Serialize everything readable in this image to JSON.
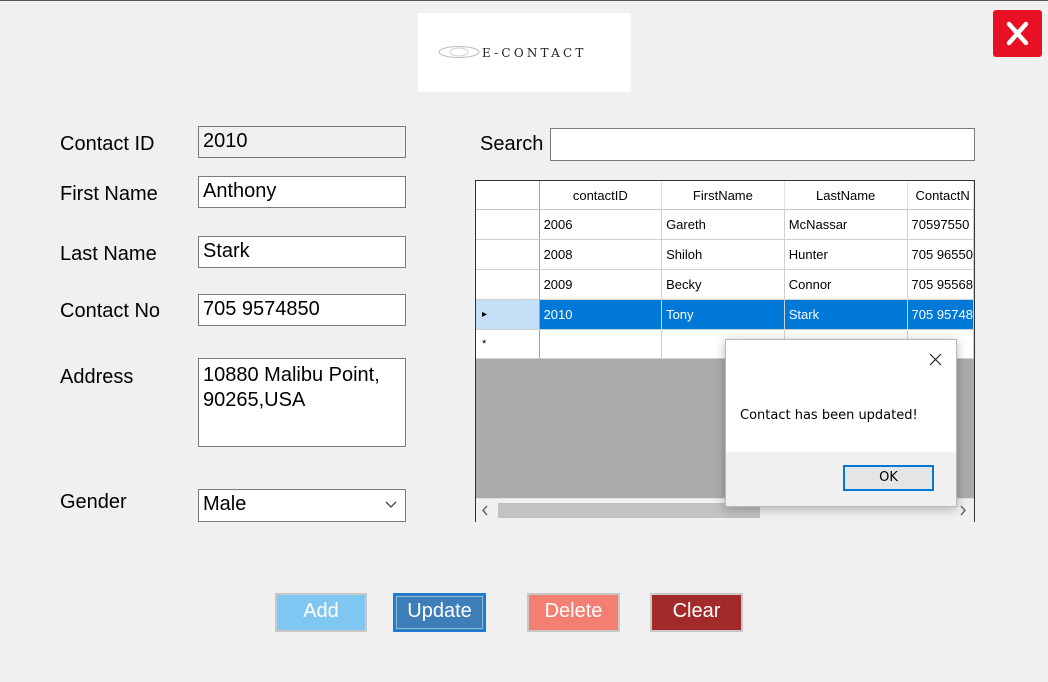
{
  "logo": {
    "text": "E-CONTACT"
  },
  "form": {
    "contact_id_label": "Contact ID",
    "contact_id_value": "2010",
    "first_name_label": "First Name",
    "first_name_value": "Anthony",
    "last_name_label": "Last Name",
    "last_name_value": "Stark",
    "contact_no_label": "Contact No",
    "contact_no_value": "705 9574850",
    "address_label": "Address",
    "address_value": "10880 Malibu Point, 90265,USA",
    "gender_label": "Gender",
    "gender_value": "Male"
  },
  "search": {
    "label": "Search",
    "value": ""
  },
  "grid": {
    "headers": [
      "contactID",
      "FirstName",
      "LastName",
      "ContactN"
    ],
    "rows": [
      {
        "contactID": "2006",
        "FirstName": "Gareth",
        "LastName": "McNassar",
        "ContactNo": "70597550"
      },
      {
        "contactID": "2008",
        "FirstName": "Shiloh",
        "LastName": "Hunter",
        "ContactNo": "705 96550"
      },
      {
        "contactID": "2009",
        "FirstName": "Becky",
        "LastName": "Connor",
        "ContactNo": "705 95568"
      },
      {
        "contactID": "2010",
        "FirstName": "Tony",
        "LastName": "Stark",
        "ContactNo": "705 95748"
      }
    ],
    "selected_marker": "▸",
    "new_row_marker": "*"
  },
  "dialog": {
    "message": "Contact has been updated!",
    "ok_label": "OK"
  },
  "buttons": {
    "add": "Add",
    "update": "Update",
    "delete": "Delete",
    "clear": "Clear"
  },
  "colors": {
    "close": "#e81123",
    "add": "#80c6f3",
    "update": "#3d7eb8",
    "delete": "#f37f72",
    "clear": "#a32a2a",
    "selection": "#0078d7"
  }
}
